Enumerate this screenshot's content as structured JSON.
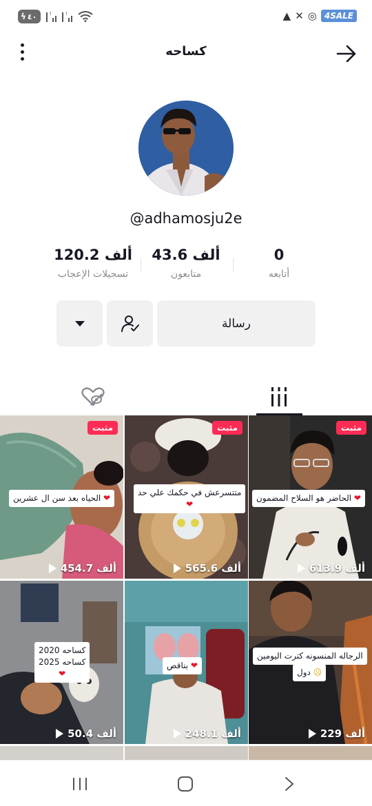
{
  "status_bar": {
    "battery": "٤٠",
    "sale_badge": "4SALE"
  },
  "header": {
    "title": "كساحه"
  },
  "profile": {
    "username": "@adhamosju2e"
  },
  "stats": [
    {
      "number": "0",
      "label": "أتابعه"
    },
    {
      "number": "43.6 ألف",
      "label": "متابعون"
    },
    {
      "number": "120.2 ألف",
      "label": "تسجيلات الإعجاب"
    }
  ],
  "actions": {
    "message_label": "رسالة"
  },
  "videos": [
    {
      "pinned": "مثبت",
      "caption": "الحاضر هو السلاح المضمون",
      "views": "613.9 ألف"
    },
    {
      "pinned": "مثبت",
      "caption": "متتسرعش في حكمك علي حد",
      "views": "565.6 ألف"
    },
    {
      "pinned": "مثبت",
      "caption": "الحياه بعد سن ال عشرين",
      "views": "454.7 ألف"
    },
    {
      "caption": "الرجاله المنسونه كترت اليومين",
      "caption2": "دول",
      "views": "229 ألف"
    },
    {
      "caption": "بناقص",
      "views": "248.1 ألف"
    },
    {
      "caption": "كساحه 2020",
      "caption2": "كساحه 2025",
      "views": "50.4 ألف"
    }
  ],
  "colors": {
    "pinned": "#fe2c55",
    "accent_text": "#161823",
    "muted": "#8a8b91",
    "button_bg": "#f1f1f2"
  }
}
